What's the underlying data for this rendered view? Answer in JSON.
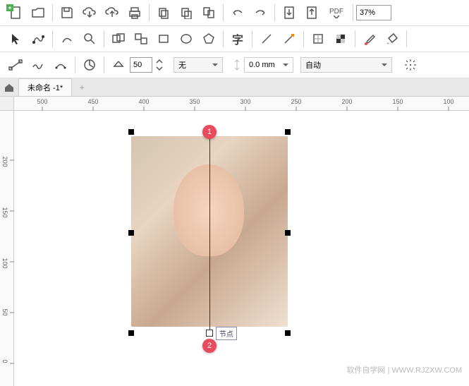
{
  "toolbar1": {
    "zoom": "37%"
  },
  "toolbar_icons": {
    "new": "new-document",
    "open": "open-folder",
    "save": "save",
    "cloud_down": "cloud-download",
    "cloud_up": "cloud-upload",
    "print": "print",
    "copy1": "copy",
    "copy2": "paste",
    "copy3": "duplicate",
    "undo": "undo",
    "redo": "redo",
    "import": "import",
    "export": "export",
    "pdf": "PDF"
  },
  "toolbar2_icons": {
    "pick": "pick-tool",
    "shape": "shape-tool",
    "freehand": "freehand-tool",
    "zoom": "zoom-tool",
    "group": "group",
    "ungroup": "ungroup",
    "rect": "rectangle-tool",
    "ellipse": "ellipse-tool",
    "polygon": "polygon-tool",
    "text": "text-tool",
    "line": "line-tool",
    "fill": "fill-tool",
    "eyedrop": "eyedropper",
    "outline": "outline",
    "transparency": "transparency",
    "dropper": "color-dropper",
    "bucket": "paint-bucket"
  },
  "propbar": {
    "rotation": "50",
    "line_style": "无",
    "width_value": "0.0 mm",
    "wrap": "自动"
  },
  "tabs": {
    "document": "未命名 -1*"
  },
  "ruler_h": [
    "500",
    "450",
    "400",
    "350",
    "300",
    "250",
    "200",
    "150",
    "100"
  ],
  "ruler_v": [
    "200",
    "150",
    "100",
    "50",
    "0"
  ],
  "markers": {
    "m1": "1",
    "m2": "2"
  },
  "node_label": "节点",
  "watermark": "软件自学网 | WWW.RJZXW.COM"
}
